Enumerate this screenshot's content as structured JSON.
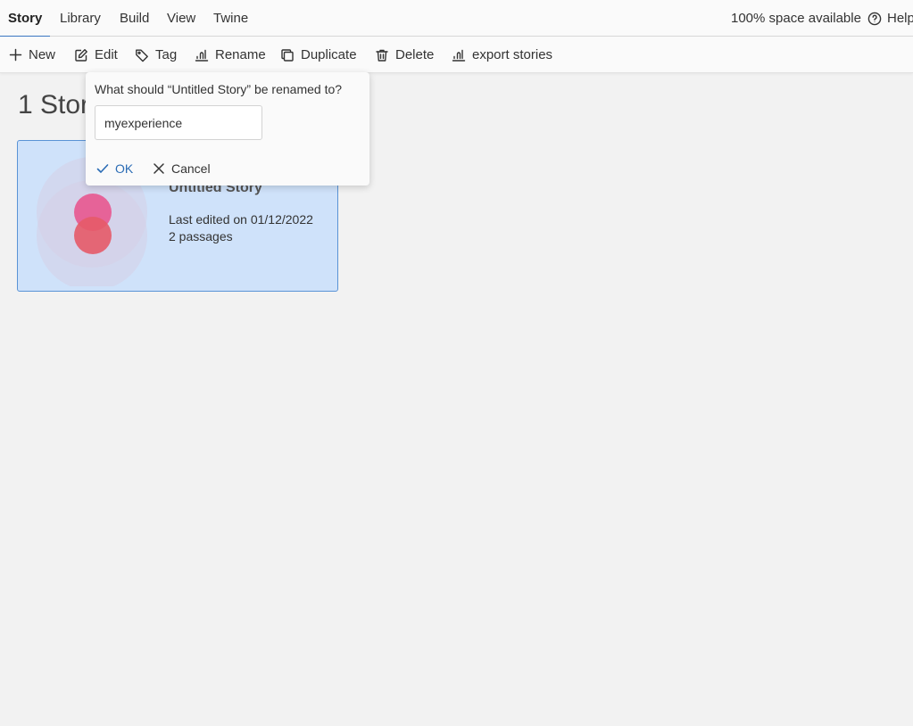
{
  "menu": {
    "tabs": [
      {
        "label": "Story",
        "active": true
      },
      {
        "label": "Library"
      },
      {
        "label": "Build"
      },
      {
        "label": "View"
      },
      {
        "label": "Twine"
      }
    ],
    "space_available": "100% space available",
    "help_label": "Help"
  },
  "toolbar": {
    "new_label": "New",
    "edit_label": "Edit",
    "tag_label": "Tag",
    "rename_label": "Rename",
    "duplicate_label": "Duplicate",
    "delete_label": "Delete",
    "export_label": "export stories"
  },
  "main": {
    "heading": "1 Stories"
  },
  "story_card": {
    "title": "Untitled Story",
    "last_edited": "Last edited on 01/12/2022",
    "passages": "2 passages",
    "selected": true
  },
  "rename_dialog": {
    "prompt": "What should “Untitled Story” be renamed to?",
    "input_value": "myexperience",
    "ok_label": "OK",
    "cancel_label": "Cancel"
  },
  "colors": {
    "accent": "#3b78c4",
    "card_background": "#cfe2fa",
    "card_border": "#5a93d6",
    "passage_pink": "#e8578f",
    "passage_red": "#e65a68",
    "ok_text": "#2b6cb5"
  },
  "icons": {
    "help": "help-circle-icon",
    "new": "plus-icon",
    "edit": "pencil-square-icon",
    "tag": "tag-icon",
    "rename": "rename-icon",
    "duplicate": "copy-icon",
    "delete": "trash-icon",
    "export": "export-icon",
    "ok": "check-icon",
    "cancel": "x-icon"
  }
}
